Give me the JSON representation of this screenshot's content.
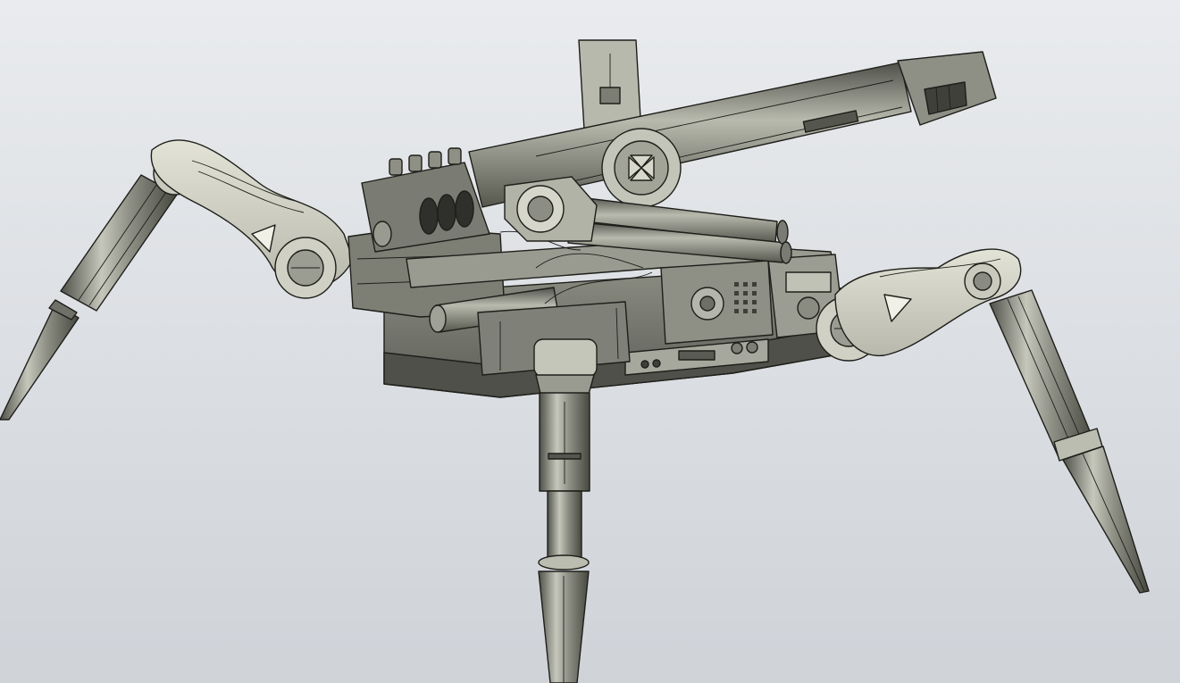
{
  "viewport": {
    "background_top": "#e9ebee",
    "background_bottom": "#cfd3d8"
  },
  "model": {
    "name": "",
    "colors": {
      "body_dark": "#65665d",
      "body_mid": "#8d8e84",
      "body_light": "#b4b5aa",
      "arm_light": "#d6d7c9",
      "metal": "#a9aa9f",
      "edge": "#1e1e1a"
    }
  }
}
